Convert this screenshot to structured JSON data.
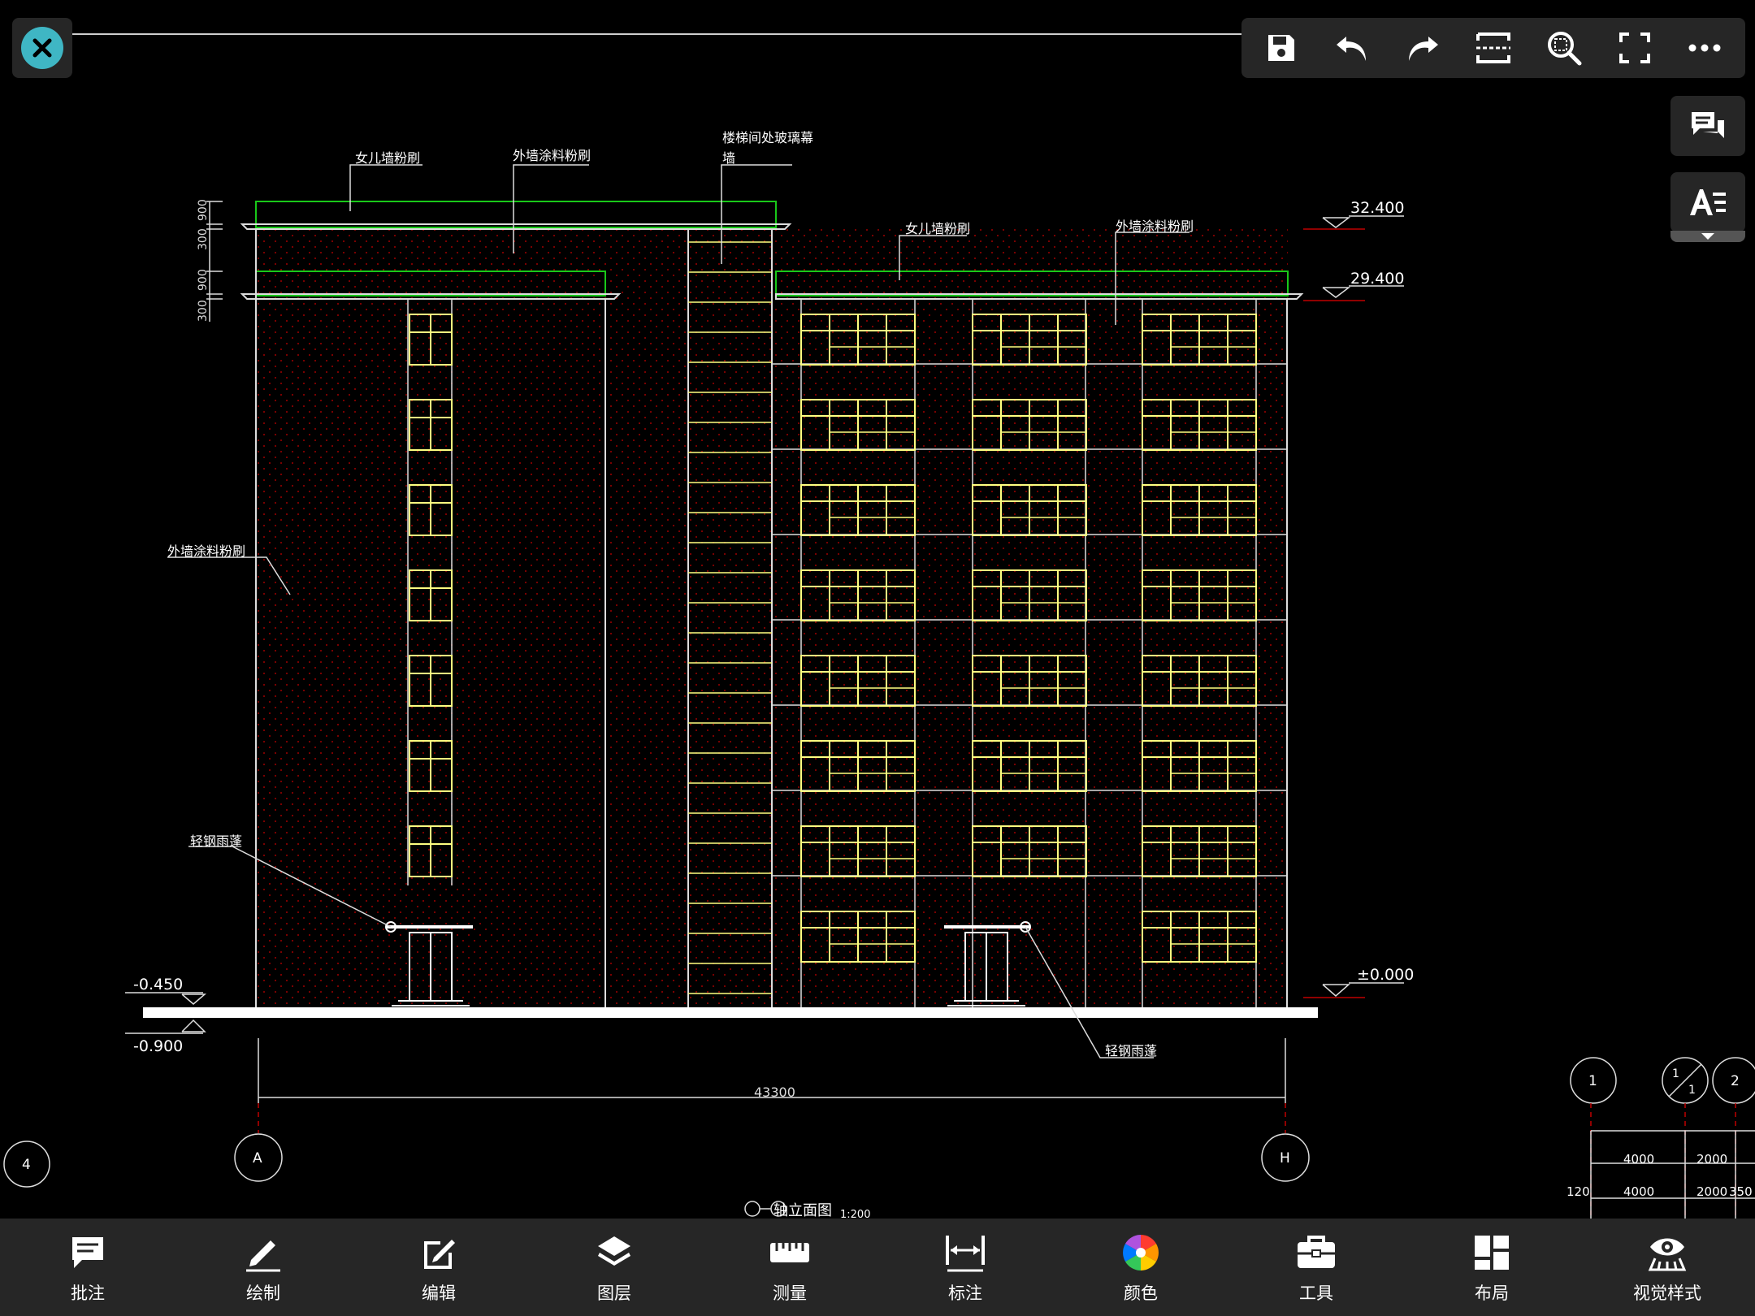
{
  "drawing": {
    "annotations": {
      "parapet_left": "女儿墙粉刷",
      "wall_top": "外墙涂料粉刷",
      "stair_glass_line1": "楼梯间处玻璃幕",
      "stair_glass_line2": "墙",
      "parapet_right": "女儿墙粉刷",
      "wall_right": "外墙涂料粉刷",
      "wall_left": "外墙涂料粉刷",
      "canopy_left": "轻钢雨蓬",
      "canopy_right": "轻钢雨蓬"
    },
    "elevations": {
      "top": "32.400",
      "upper": "29.400",
      "ground": "±0.000",
      "minus_1": "-0.450",
      "minus_2": "-0.900"
    },
    "left_dims": [
      "900",
      "300",
      "900",
      "300"
    ],
    "dimension_total": "43300",
    "axis_labels": [
      "A",
      "H",
      "4",
      "1",
      "1",
      "1",
      "2"
    ],
    "title": "轴立面图",
    "scale": "1:200",
    "right_dims": [
      "4000",
      "2000",
      "4000",
      "2000",
      "350",
      "120"
    ]
  },
  "top_toolbar": {
    "icons": [
      "save-icon",
      "undo-icon",
      "redo-icon",
      "crop-icon",
      "zoom-icon",
      "fullscreen-icon",
      "more-icon"
    ]
  },
  "side_tools": [
    "comment-icon",
    "text-style-icon"
  ],
  "bottom_toolbar": [
    {
      "label": "批注",
      "icon": "annotate-icon"
    },
    {
      "label": "绘制",
      "icon": "pencil-icon"
    },
    {
      "label": "编辑",
      "icon": "edit-icon"
    },
    {
      "label": "图层",
      "icon": "layers-icon"
    },
    {
      "label": "测量",
      "icon": "ruler-icon"
    },
    {
      "label": "标注",
      "icon": "dimension-icon"
    },
    {
      "label": "颜色",
      "icon": "color-wheel-icon"
    },
    {
      "label": "工具",
      "icon": "toolbox-icon"
    },
    {
      "label": "布局",
      "icon": "layout-icon"
    },
    {
      "label": "视觉样式",
      "icon": "visual-style-icon"
    }
  ],
  "colors": {
    "accent": "#3fb6c4",
    "window_yellow": "#ffff80",
    "parapet_green": "#19c819",
    "hatch_red": "#c00000",
    "toolbar_bg": "#262626"
  }
}
